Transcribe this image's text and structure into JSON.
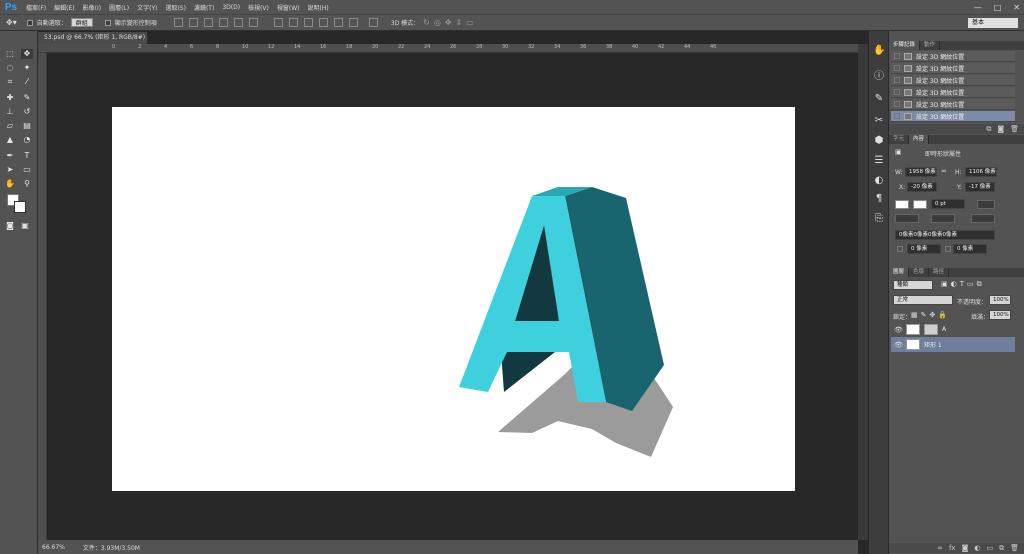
{
  "app": {
    "logo": "Ps"
  },
  "menu": [
    "檔案(F)",
    "編輯(E)",
    "影像(I)",
    "圖層(L)",
    "文字(Y)",
    "選取(S)",
    "濾鏡(T)",
    "3D(D)",
    "檢視(V)",
    "視窗(W)",
    "說明(H)"
  ],
  "window_buttons": {
    "minimize": "—",
    "maximize": "□",
    "close": "✕"
  },
  "options": {
    "auto_select_label": "自動選取：",
    "auto_select_value": "群組",
    "show_transform_label": "顯示變形控制項",
    "mode_3d_label": "3D 模式：",
    "workspace": "基本"
  },
  "document": {
    "tab": "53.psd @ 66.7% (矩形 1, RGB/8#) *",
    "ruler_ticks": [
      "0",
      "2",
      "4",
      "6",
      "8",
      "10",
      "12",
      "14",
      "16",
      "18",
      "20",
      "22",
      "24",
      "26",
      "28",
      "30",
      "32",
      "34",
      "36",
      "38",
      "40",
      "42",
      "44",
      "46"
    ]
  },
  "status": {
    "zoom": "66.67%",
    "doc": "文件：3.93M/3.50M"
  },
  "history": {
    "tabs": [
      "步驟記錄",
      "動作"
    ],
    "rows": [
      "設定 3D 網紋位置",
      "設定 3D 網紋位置",
      "設定 3D 網紋位置",
      "設定 3D 網紋位置",
      "設定 3D 網紋位置",
      "設定 3D 網紋位置"
    ]
  },
  "properties": {
    "tabs": [
      "字元",
      "內容"
    ],
    "title": "即時形狀屬性",
    "w_label": "W:",
    "w_value": "1958 像素",
    "h_label": "H:",
    "h_value": "1106 像素",
    "x_label": "X:",
    "x_value": "-20 像素",
    "y_label": "Y:",
    "y_value": "-17 像素",
    "stroke_value": "0 pt",
    "corner_text": "0像素0像素0像素0像素",
    "corner_a": "0 像素",
    "corner_b": "0 像素"
  },
  "layers": {
    "tabs": [
      "圖層",
      "色版",
      "路徑"
    ],
    "kind_label": "種類",
    "blend_mode": "正常",
    "opacity_label": "不透明度：",
    "opacity_value": "100%",
    "lock_label": "鎖定：",
    "fill_label": "填滿：",
    "fill_value": "100%",
    "items": [
      {
        "name": "A"
      },
      {
        "name": "矩形 1"
      }
    ]
  },
  "colors": {
    "letter_face": "#3fd0de",
    "letter_side": "#18656f",
    "letter_top": "#2aa7b4",
    "letter_inner": "#12393f",
    "shadow": "#9b9b9b"
  }
}
